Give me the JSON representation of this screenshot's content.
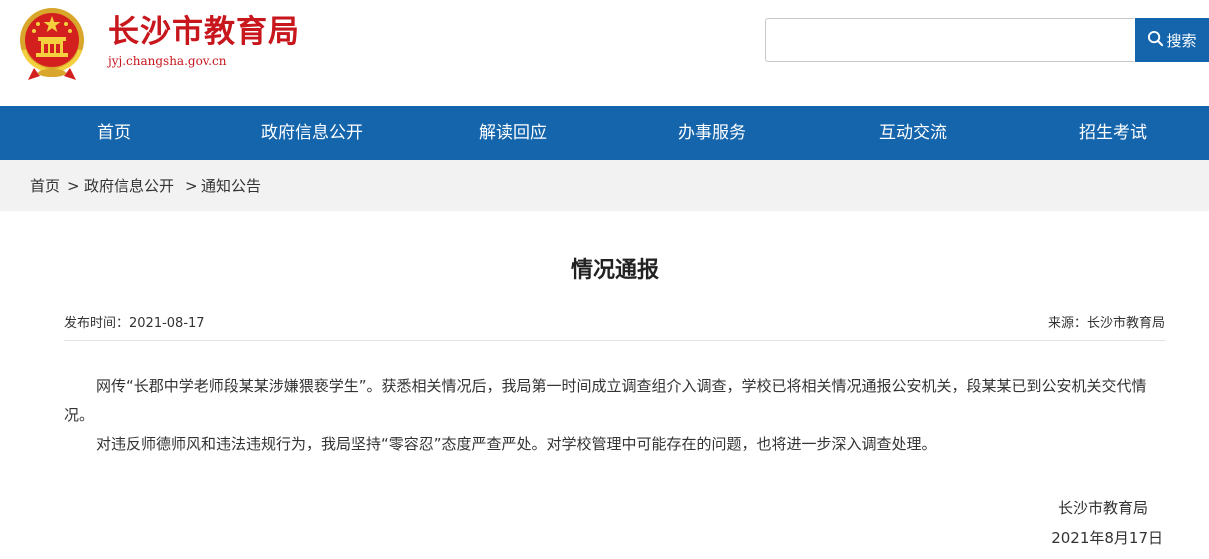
{
  "site": {
    "title": "长沙市教育局",
    "domain": "jyj.changsha.gov.cn"
  },
  "search": {
    "placeholder": "",
    "button_label": "搜索"
  },
  "nav": {
    "items": [
      "首页",
      "政府信息公开",
      "解读回应",
      "办事服务",
      "互动交流",
      "招生考试"
    ]
  },
  "breadcrumb": {
    "items": [
      "首页",
      "政府信息公开",
      "通知公告"
    ],
    "separator": ">"
  },
  "article": {
    "title": "情况通报",
    "publish_time": "发布时间：2021-08-17",
    "source": "来源：长沙市教育局",
    "paragraphs": [
      "网传“长郡中学老师段某某涉嫌猥亵学生”。获悉相关情况后，我局第一时间成立调查组介入调查，学校已将相关情况通报公安机关，段某某已到公安机关交代情况。",
      "对违反师德师风和违法违规行为，我局坚持“零容忍”态度严查严处。对学校管理中可能存在的问题，也将进一步深入调查处理。"
    ],
    "signature": "长沙市教育局",
    "date": "2021年8月17日"
  },
  "colors": {
    "brand_red": "#c8161d",
    "nav_blue": "#1565ad",
    "breadcrumb_bg": "#f2f2f2"
  },
  "icons": {
    "emblem": "national-emblem-icon",
    "search": "search-icon"
  }
}
